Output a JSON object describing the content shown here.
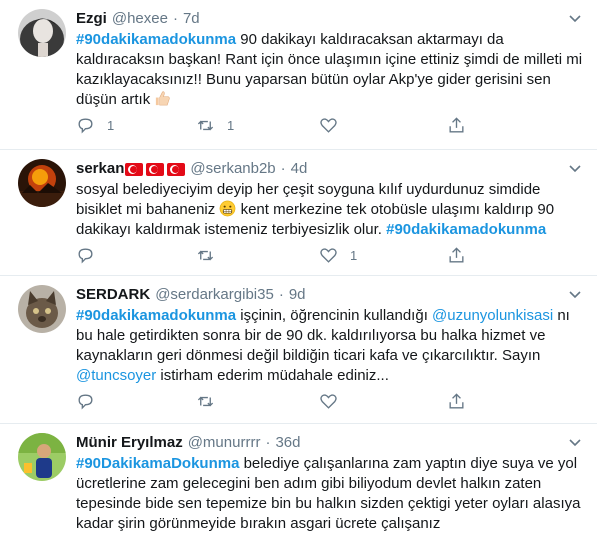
{
  "tweets": [
    {
      "name": "Ezgi",
      "handle": "@hexee",
      "dot": "·",
      "time": "7d",
      "hashtag": "#90dakikamadokunma",
      "text_1": " 90 dakikayı kaldıracaksan aktarmayı da",
      "text_2": "kaldıracaksın başkan! Rant için önce ulaşımın içine ettiniz şimdi de milleti mi",
      "text_3": "kazıklayacaksınız!! Bunu yaparsan bütün oylar Akp'ye gider gerisini sen",
      "text_4": "düşün artık",
      "emoji": "thumbs-up-emoji",
      "replies": "1",
      "retweets": "1",
      "likes": ""
    },
    {
      "name": "serkan",
      "handle": "@serkanb2b",
      "dot": "·",
      "time": "4d",
      "flags": [
        "turkey-flag",
        "turkey-flag",
        "turkey-flag"
      ],
      "text_1": "sosyal belediyeciyim deyip her çeşit soyguna kılıf uydurdunuz simdide",
      "text_2a": "bisiklet mi bahaneniz",
      "text_2b": " kent merkezine tek otobüsle ulaşımı kaldırıp 90",
      "text_3": "dakikayı kaldırmak istemeniz terbiyesizlik olur. ",
      "hashtag": "#90dakikamadokunma",
      "emoji": "grimacing-face-emoji",
      "replies": "",
      "retweets": "",
      "likes": "1"
    },
    {
      "name": "SERDARK",
      "handle": "@serdarkargibi35",
      "dot": "·",
      "time": "9d",
      "hashtag": "#90dakikamadokunma",
      "text_1": " işçinin, öğrencinin kullandığı ",
      "mention_1": "@uzunyolunkisasi",
      "text_1b": " nı",
      "text_2": "bu hale getirdikten sonra bir de 90 dk. kaldırılıyorsa bu halka hizmet ve",
      "text_3": "kaynakların geri dönmesi değil bildiğin ticari kafa ve çıkarcılıktır. Sayın",
      "mention_2": "@tuncsoyer",
      "text_4": " istirham ederim müdahale ediniz...",
      "replies": "",
      "retweets": "",
      "likes": ""
    },
    {
      "name": "Münir Eryılmaz",
      "handle": "@munurrrr",
      "dot": "·",
      "time": "36d",
      "hashtag": "#90DakikamaDokunma",
      "text_1": " belediye çalışanlarına zam yaptın diye suya ve yol",
      "text_2": "ücretlerine zam gelecegini ben adım gibi biliyodum devlet halkın zaten",
      "text_3": "tepesinde bide sen tepemize bin bu halkın sizden çektigi yeter oyları alasıya",
      "text_4": "kadar şirin görünmeyide bırakın asgari ücrete çalışanız"
    }
  ],
  "colors": {
    "link": "#1b95e0",
    "muted": "#657786",
    "text": "#14171a",
    "divider": "#e6ecf0"
  },
  "icons": [
    "chevron-down-icon",
    "reply-icon",
    "retweet-icon",
    "like-icon",
    "share-icon"
  ]
}
